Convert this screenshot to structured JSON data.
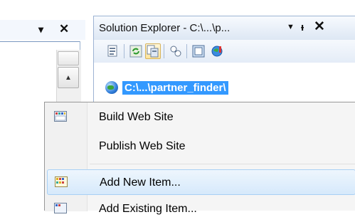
{
  "left_pane": {
    "pin_glyph": "▾",
    "close_glyph": "✕",
    "scroll_up_glyph": "▲"
  },
  "solution_explorer": {
    "title": "Solution Explorer - C:\\...\\p...",
    "dropdown_glyph": "▼",
    "pin_glyph": "ᵻ",
    "close_glyph": "✕",
    "toolbar": [
      {
        "name": "properties-icon"
      },
      {
        "name": "refresh-icon"
      },
      {
        "name": "show-all-files-icon"
      },
      {
        "name": "copy-website-icon"
      },
      {
        "name": "view-designer-icon"
      },
      {
        "name": "asp-net-configuration-icon"
      }
    ],
    "root_node_label": "C:\\...\\partner_finder\\"
  },
  "context_menu": {
    "items": [
      {
        "label": "Build Web Site",
        "icon": "build-icon"
      },
      {
        "label": "Publish Web Site",
        "icon": ""
      },
      {
        "label": "Add New Item...",
        "icon": "add-new-item-icon",
        "highlighted": true
      },
      {
        "label": "Add Existing Item...",
        "icon": "add-existing-item-icon"
      }
    ]
  }
}
